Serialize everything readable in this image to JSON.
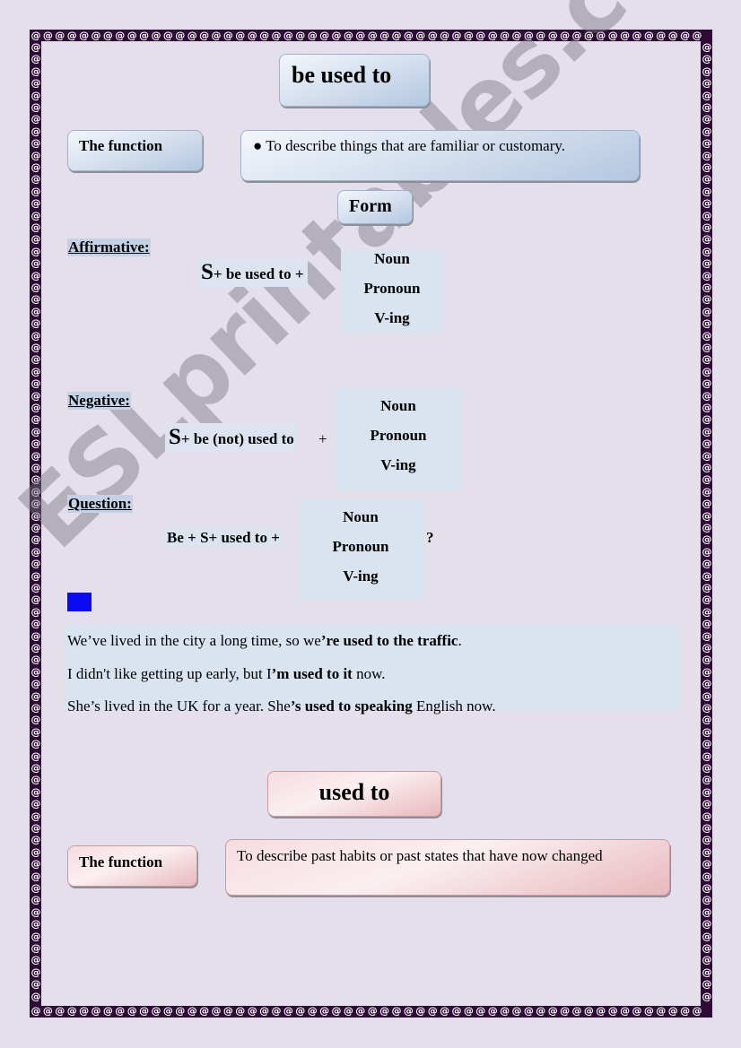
{
  "colors": {
    "page_background": "#e4dfeb",
    "border": "#2e0b36",
    "blue_box": "#d5e0ef",
    "pink_box": "#f6dcdf",
    "highlight": "#dae3f0",
    "eg_icon": "#0a0af5"
  },
  "be_used_to": {
    "title": "be used to",
    "function_label": "The function",
    "function_text": "● To describe things that are familiar or customary.",
    "form_label": "Form",
    "affirmative": {
      "label": "Affirmative:",
      "subject": "S",
      "formula": "+ be used to +",
      "options": [
        "Noun",
        "Pronoun",
        "V-ing"
      ]
    },
    "negative": {
      "label": "Negative:",
      "subject": "S",
      "formula": "+ be (not) used to",
      "plus": "+",
      "options": [
        "Noun",
        "Pronoun",
        "V-ing"
      ]
    },
    "question": {
      "label": "Question:",
      "formula": "Be + S+ used to +",
      "options": [
        "Noun",
        "Pronoun",
        "V-ing"
      ],
      "end_mark": "?"
    },
    "examples_icon": "eg-icon",
    "examples": [
      {
        "pre": "We’ve lived in the city a long time, so we",
        "bold": "’re used to the traffic",
        "post": "."
      },
      {
        "pre": "I didn't like getting up early, but I",
        "bold": "’m used to it",
        "post": " now."
      },
      {
        "pre": "She’s lived in the UK for a year. She",
        "bold": "’s used to speaking",
        "post": " English now."
      }
    ]
  },
  "used_to": {
    "title": "used to",
    "function_label": "The function",
    "function_text": "To describe past habits or past states that have now changed"
  },
  "watermark": "ESLprintables.com"
}
